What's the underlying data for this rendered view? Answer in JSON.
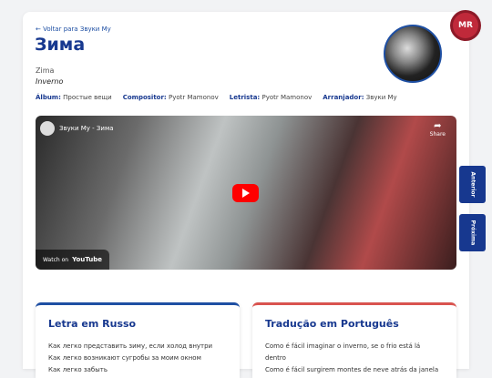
{
  "header": {
    "back_link": "← Voltar para Звуки Му",
    "title": "Зима",
    "transliteration": "Zima",
    "translation": "Inverno",
    "brand_badge": "MR"
  },
  "meta": {
    "album_label": "Álbum:",
    "album_value": "Простые вещи",
    "composer_label": "Compositor:",
    "composer_value": "Pyotr Mamonov",
    "lyricist_label": "Letrista:",
    "lyricist_value": "Pyotr Mamonov",
    "arranger_label": "Arranjador:",
    "arranger_value": "Звуки Му"
  },
  "video": {
    "title": "Звуки Му - Зима",
    "share_label": "Share",
    "watch_on": "Watch on",
    "youtube": "YouTube"
  },
  "nav": {
    "prev": "Anterior",
    "next": "Próxima"
  },
  "lyrics_ru": {
    "heading": "Letra em Russo",
    "lines": [
      "Как легко представить зиму, если холод внутри",
      "Как легко возникают сугробы за моим окном",
      "Как легко забыть"
    ]
  },
  "lyrics_pt": {
    "heading": "Tradução em Português",
    "lines": [
      "Como é fácil imaginar o inverno, se o frio está lá",
      "dentro",
      "Como é fácil surgirem montes de neve atrás da janela"
    ]
  },
  "colors": {
    "primary": "#17388f",
    "accent_red": "#d9534f",
    "youtube_red": "#ff0000"
  }
}
